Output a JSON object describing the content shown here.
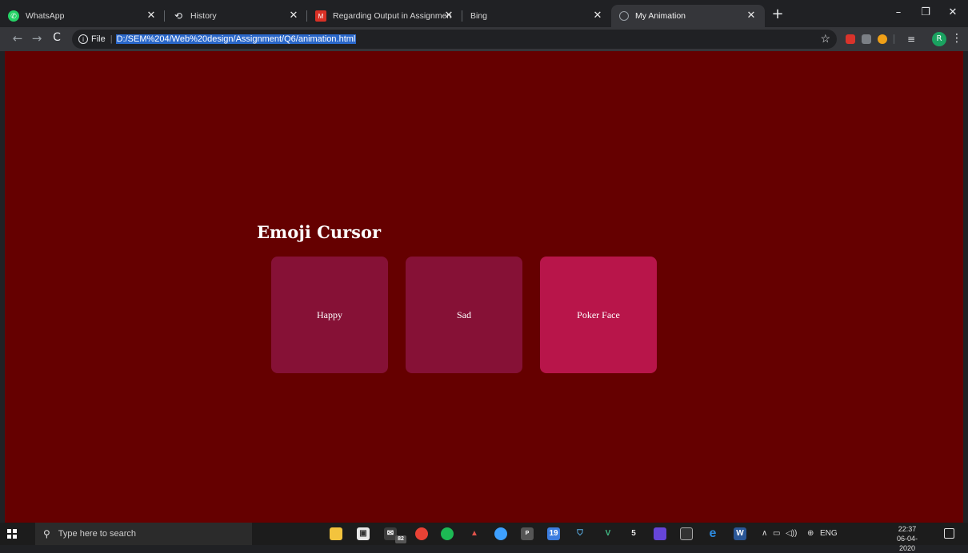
{
  "browser": {
    "tabs": [
      {
        "title": "WhatsApp",
        "icon": "whatsapp-icon",
        "color": "#25d366",
        "active": false
      },
      {
        "title": "History",
        "icon": "history-icon",
        "active": false
      },
      {
        "title": "Regarding Output in Assignment",
        "icon": "gmail-icon",
        "color": "#d93025",
        "active": false
      },
      {
        "title": "Bing",
        "icon": "bing-icon",
        "active": false
      },
      {
        "title": "My Animation",
        "icon": "globe-icon",
        "active": true
      }
    ],
    "new_tab_label": "+",
    "window_controls": {
      "minimize": "–",
      "restore": "❐",
      "close": "✕"
    },
    "address": {
      "scheme_label": "File",
      "url": "D:/SEM%204/Web%20design/Assignment/Q6/animation.html"
    },
    "profile_initial": "R",
    "accent_selection": "#2a67c9"
  },
  "page": {
    "background": "#650000",
    "heading": "Emoji Cursor",
    "cards": [
      {
        "label": "Happy",
        "color": "#861136"
      },
      {
        "label": "Sad",
        "color": "#861136"
      },
      {
        "label": "Poker Face",
        "color": "#b8154a"
      }
    ]
  },
  "taskbar": {
    "search_placeholder": "Type here to search",
    "mail_badge": "82",
    "calendar_day": "19",
    "tray_language": "ENG",
    "time": "22:37",
    "date": "06-04-2020"
  }
}
